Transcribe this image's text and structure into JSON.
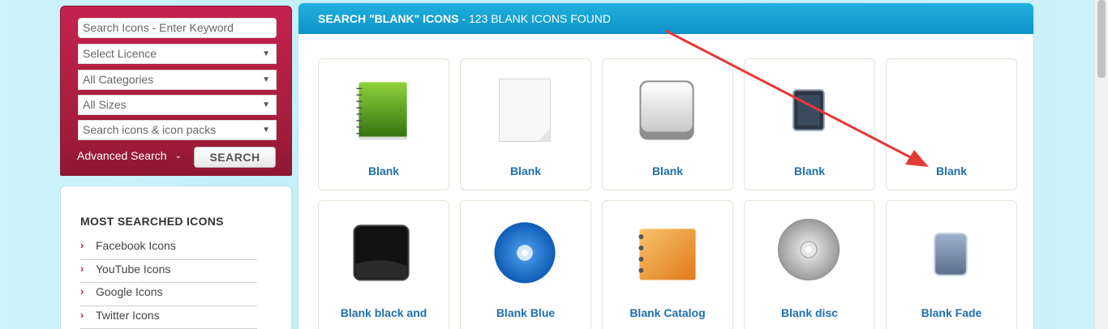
{
  "search": {
    "keyword_placeholder": "Search Icons - Enter Keyword",
    "licence": "Select Licence",
    "categories": "All Categories",
    "sizes": "All Sizes",
    "type": "Search icons & icon packs",
    "advanced_label": "Advanced Search",
    "button_label": "SEARCH"
  },
  "most_searched": {
    "title": "MOST SEARCHED ICONS",
    "items": [
      "Facebook Icons",
      "YouTube Icons",
      "Google Icons",
      "Twitter Icons"
    ]
  },
  "results": {
    "title_bold": "SEARCH \"BLANK\" ICONS",
    "title_rest": " - 123 BLANK ICONS FOUND",
    "icons": [
      {
        "label": "Blank",
        "icon": "green-notebook-icon"
      },
      {
        "label": "Blank",
        "icon": "blank-paper-icon"
      },
      {
        "label": "Blank",
        "icon": "blank-key-icon"
      },
      {
        "label": "Blank",
        "icon": "dark-tablet-icon"
      },
      {
        "label": "Blank",
        "icon": "empty-icon"
      },
      {
        "label": "Blank black and",
        "icon": "black-square-icon"
      },
      {
        "label": "Blank Blue",
        "icon": "blue-disc-icon"
      },
      {
        "label": "Blank Catalog",
        "icon": "orange-catalog-icon"
      },
      {
        "label": "Blank disc",
        "icon": "silver-disc-icon"
      },
      {
        "label": "Blank Fade",
        "icon": "fade-tablet-icon"
      }
    ]
  },
  "colors": {
    "accent_red": "#c4234d",
    "header_blue": "#1aa5d9",
    "link_blue": "#1d6fb0",
    "annotation_arrow": "#e53935"
  }
}
